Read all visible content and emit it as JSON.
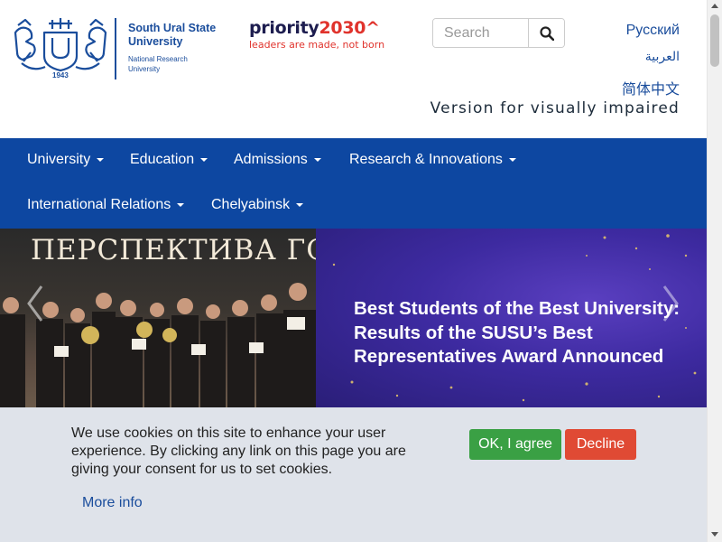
{
  "header": {
    "logo_name": "South Ural State University",
    "logo_sub": "National Research University",
    "logo_year": "1943",
    "priority_word": "priority",
    "priority_year": "2030^",
    "priority_tagline": "leaders are made, not born",
    "search_placeholder": "Search",
    "search_icon": "search-icon",
    "lang_ru": "Русский",
    "lang_ar": "العربية",
    "lang_zh": "简体中文",
    "visually_impaired": "Version for visually impaired"
  },
  "nav": {
    "items": [
      {
        "label": "University"
      },
      {
        "label": "Education"
      },
      {
        "label": "Admissions"
      },
      {
        "label": "Research & Innovations"
      },
      {
        "label": "International Relations"
      },
      {
        "label": "Chelyabinsk"
      }
    ]
  },
  "banner": {
    "photo_title": "ПЕРСПЕКТИВА ГОДА",
    "headline": "Best Students of the Best University: Results of the SUSU’s Best Representatives Award Announced"
  },
  "cookie": {
    "message": "We use cookies on this site to enhance your user experience. By clicking any link on this page you are giving your consent for us to set cookies.",
    "more_info": "More info",
    "agree": "OK, I agree",
    "decline": "Decline"
  },
  "colors": {
    "brand_blue": "#1a4d9c",
    "nav_blue": "#0d47a1",
    "agree_green": "#3aa044",
    "decline_red": "#e04a34",
    "priority_red": "#e0332c",
    "cookie_bg": "#dfe3ea"
  }
}
